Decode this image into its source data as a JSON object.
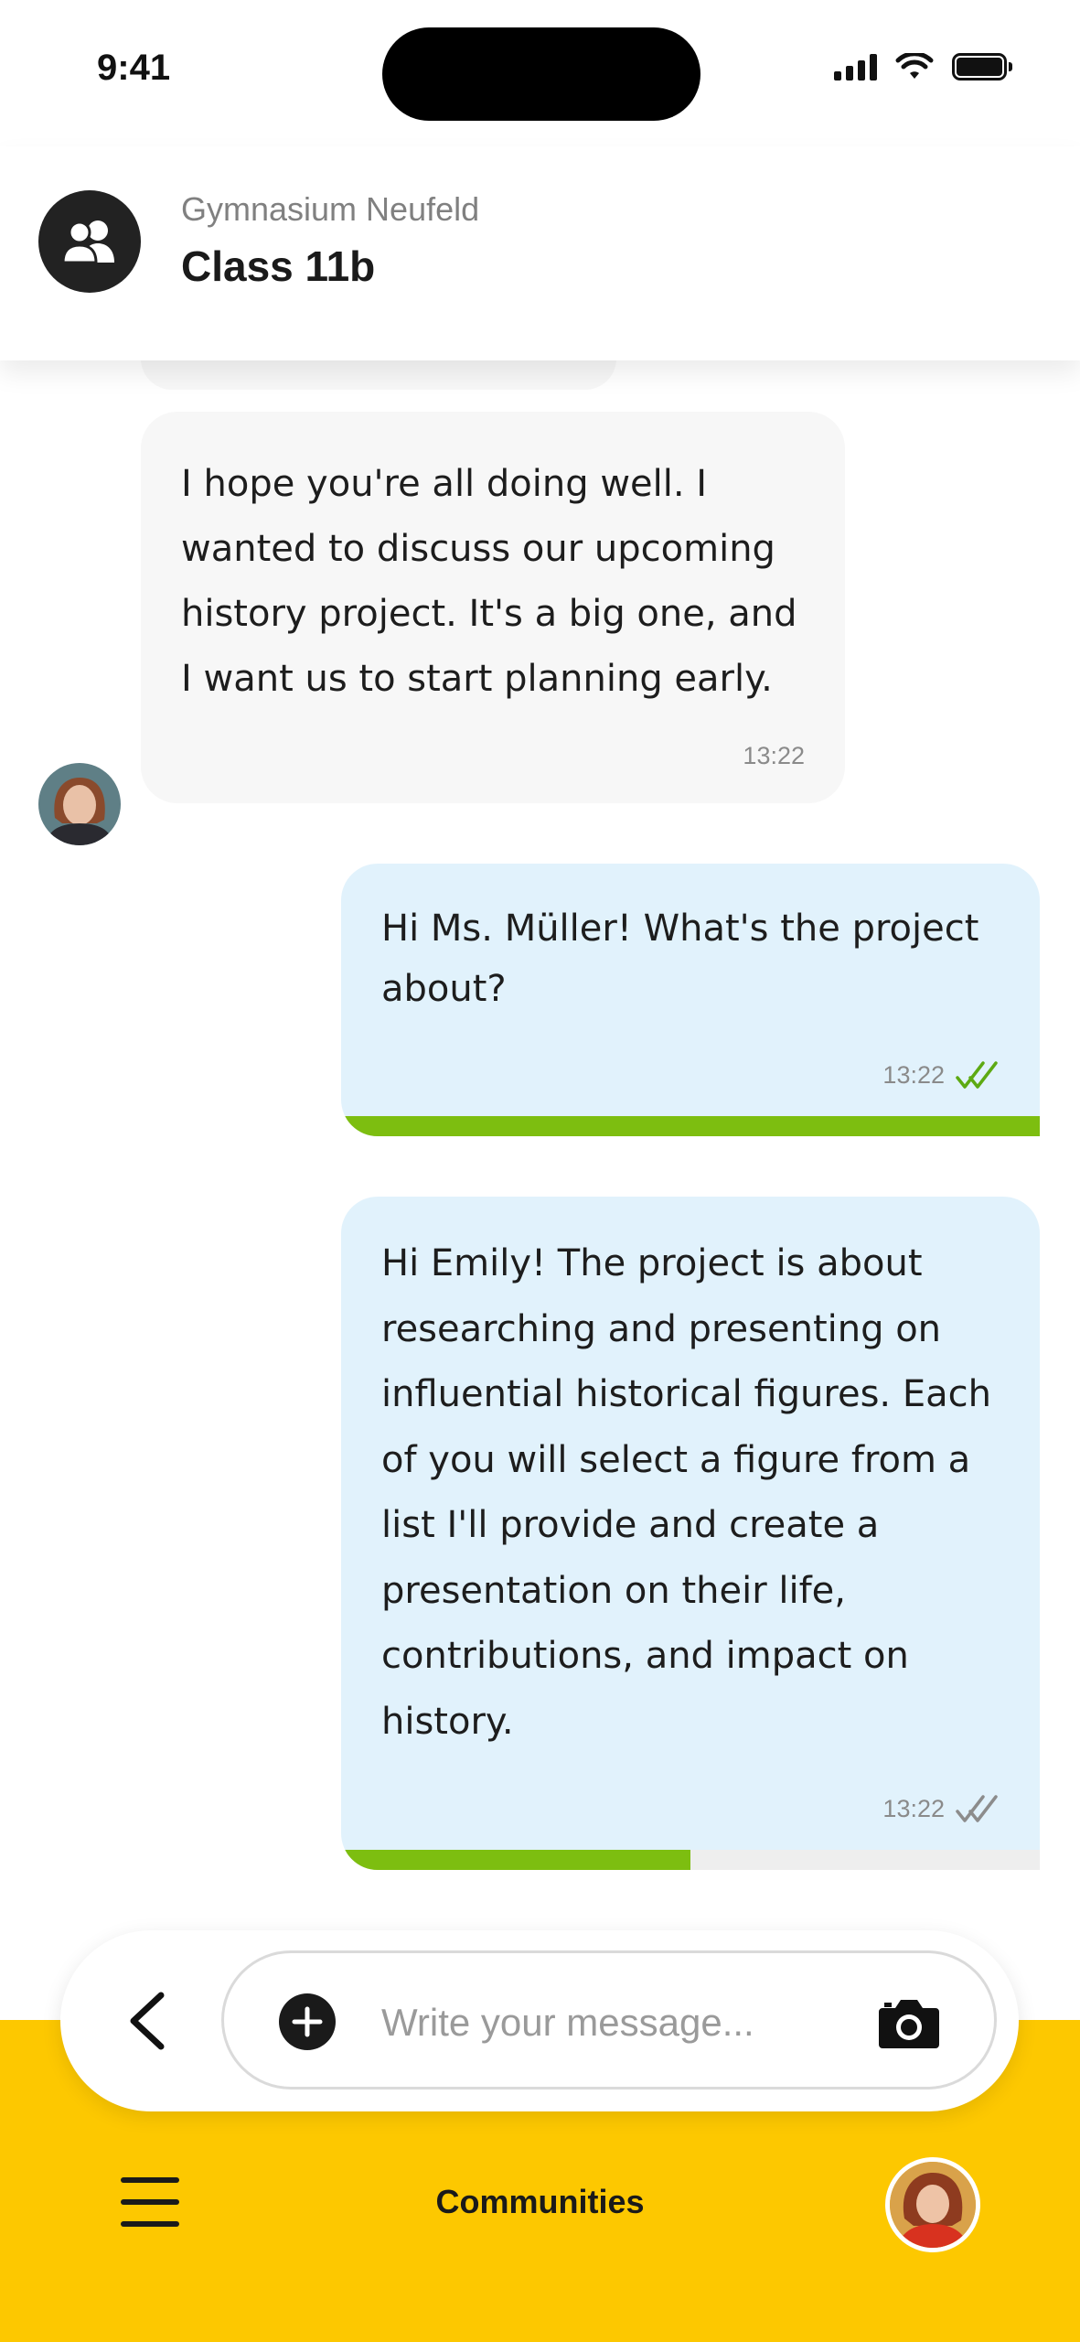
{
  "status_bar": {
    "time": "9:41"
  },
  "header": {
    "organization": "Gymnasium Neufeld",
    "group_name": "Class 11b",
    "avatar_icon": "group-icon"
  },
  "messages": [
    {
      "direction": "incoming",
      "text": "I hope you're all doing well. I wanted to discuss our upcoming history project. It's a big one, and I want us to start planning early.",
      "time": "13:22"
    },
    {
      "direction": "outgoing",
      "text": "Hi Ms. Müller! What's the project about?",
      "time": "13:22",
      "read_status": "read",
      "progress": 1.0
    },
    {
      "direction": "outgoing",
      "text": "Hi Emily! The project is about researching and presenting on influential historical figures. Each of you will select a figure from a list I'll provide and create a presentation on their life, contributions, and impact on history.",
      "time": "13:22",
      "read_status": "delivered",
      "progress": 0.5
    }
  ],
  "composer": {
    "placeholder": "Write your message...",
    "back_icon": "chevron-left-icon",
    "add_icon": "plus-circle-icon",
    "camera_icon": "camera-icon"
  },
  "bottom_nav": {
    "title": "Communities",
    "menu_icon": "hamburger-menu-icon"
  },
  "colors": {
    "accent_yellow": "#FDC800",
    "outgoing_bubble": "#E1F2FC",
    "incoming_bubble": "#F7F7F7",
    "progress_green": "#7DBE10",
    "read_check": "#5DAA12"
  }
}
